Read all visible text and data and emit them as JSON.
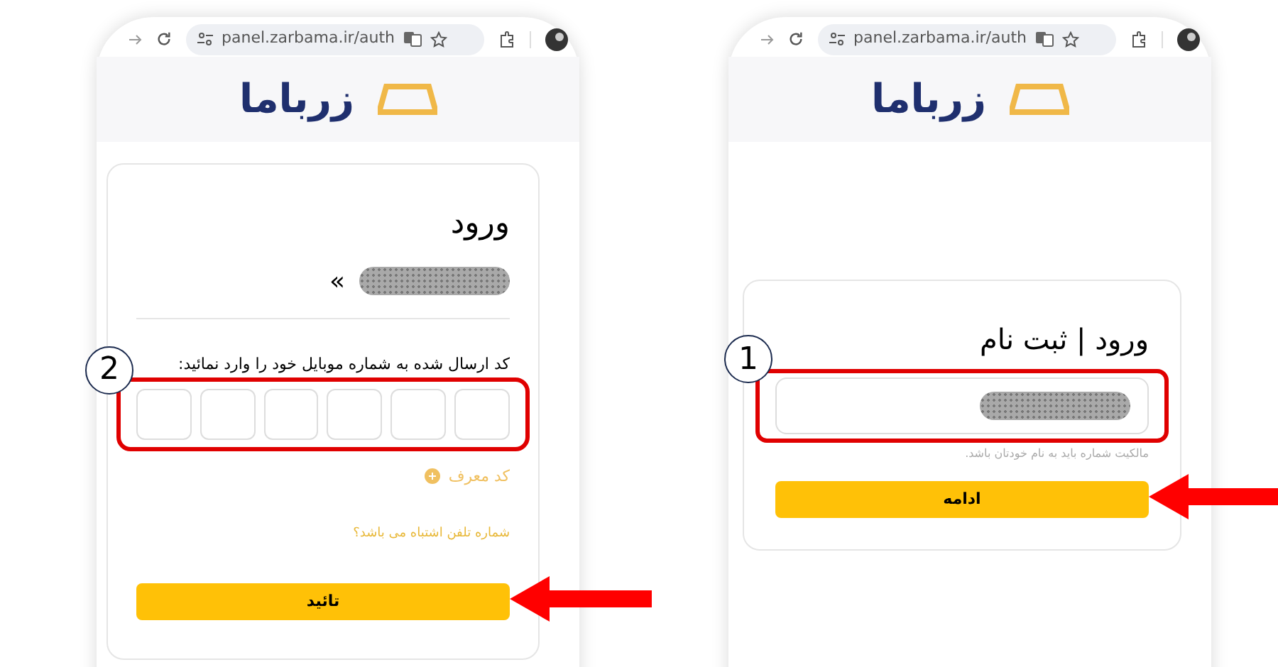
{
  "phones": [
    {
      "browser": {
        "url": "panel.zarbama.ir/auth"
      },
      "logo": "زرباما",
      "card": {
        "kind": "phone",
        "title": "ورود | ثبت نام",
        "hint": "مالکیت شماره باید به نام خودتان باشد.",
        "button": "ادامه",
        "step": "1"
      }
    },
    {
      "browser": {
        "url": "panel.zarbama.ir/auth"
      },
      "logo": "زرباما",
      "card": {
        "kind": "otp",
        "title": "ورود",
        "phone_prefix": "»",
        "instruction": "کد ارسال شده به شماره موبایل خود را وارد نمائید:",
        "code_digits": [
          {
            "filled": false
          },
          {
            "filled": false
          },
          {
            "filled": false
          },
          {
            "filled": false
          },
          {
            "filled": false
          },
          {
            "filled": false
          }
        ],
        "referral": "کد معرف",
        "wrong_number_link": "شماره تلفن اشتباه می باشد؟",
        "button": "تائید",
        "step": "2"
      }
    }
  ]
}
